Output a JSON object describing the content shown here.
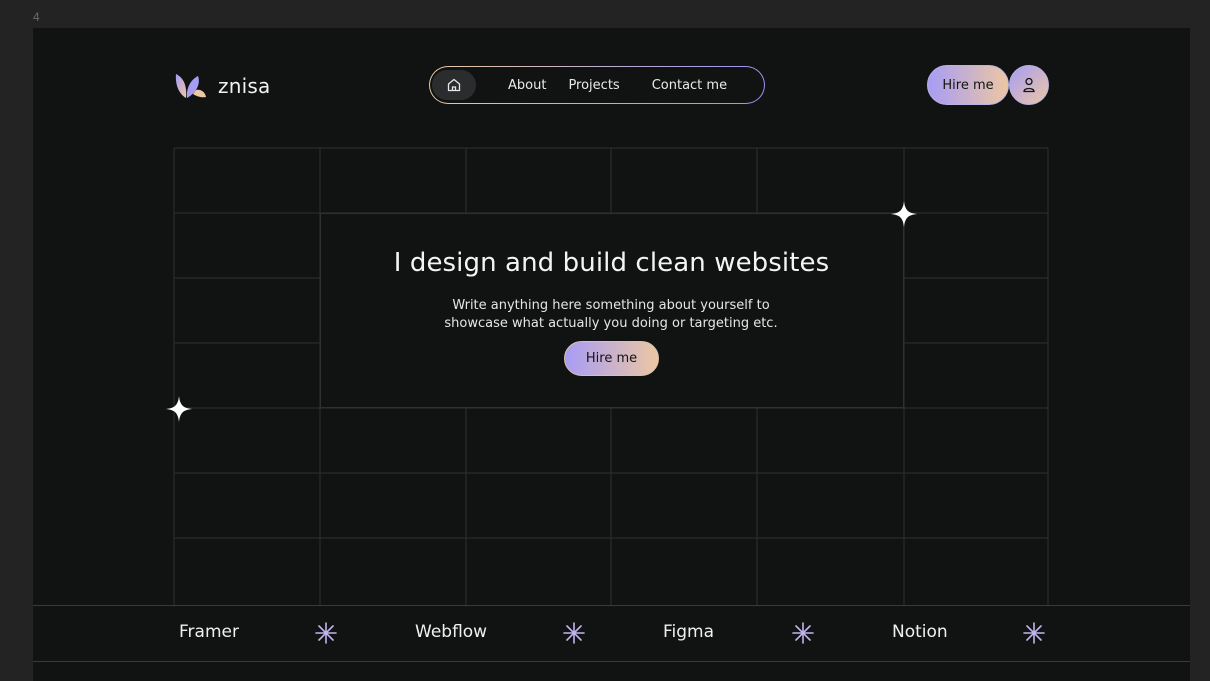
{
  "frame_label": "4",
  "brand": {
    "name": "znisa"
  },
  "nav": {
    "home_icon": "home-icon",
    "items": [
      {
        "label": "About"
      },
      {
        "label": "Projects"
      },
      {
        "label": "Contact me"
      }
    ]
  },
  "header": {
    "hire_label": "Hire me",
    "user_icon": "user-icon"
  },
  "hero": {
    "title": "I design and build clean websites",
    "subtitle_line1": "Write anything here something about yourself to",
    "subtitle_line2": "showcase what actually you doing or targeting etc.",
    "cta_label": "Hire me"
  },
  "tools": [
    {
      "name": "Framer"
    },
    {
      "name": "Webflow"
    },
    {
      "name": "Figma"
    },
    {
      "name": "Notion"
    }
  ],
  "colors": {
    "background": "#111212",
    "accent_lavender": "#a79cf5",
    "accent_peach": "#ecc7a3",
    "grid_line": "#2f3030"
  }
}
